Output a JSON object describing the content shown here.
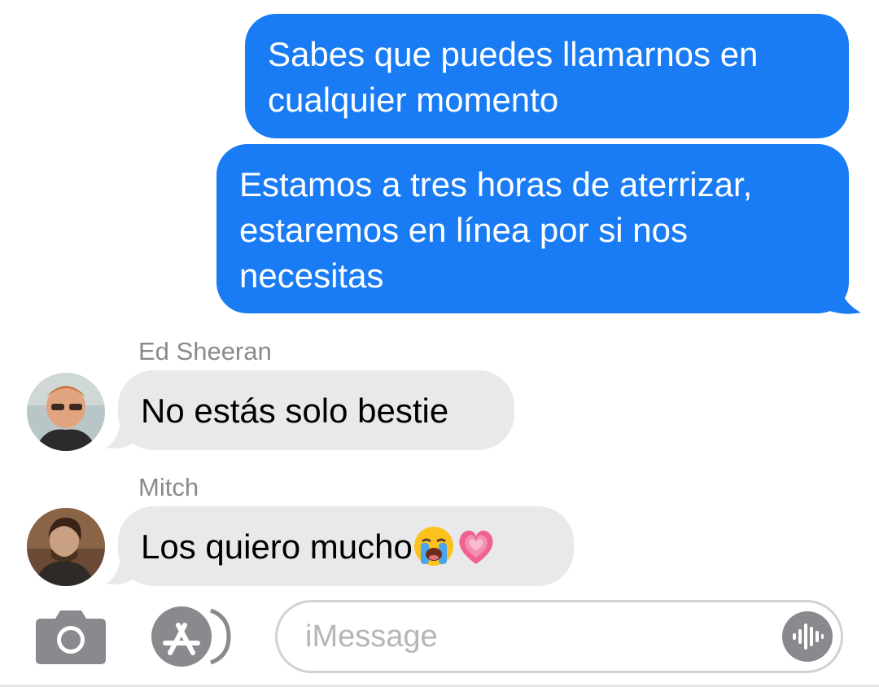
{
  "conversation": {
    "outgoing": [
      {
        "lines": [
          "Sabes que puedes llamarnos en",
          "cualquier momento"
        ]
      },
      {
        "lines": [
          "Estamos a tres horas de aterrizar,",
          "estaremos en línea por si nos",
          "necesitas"
        ]
      }
    ],
    "incoming": [
      {
        "sender": "Ed Sheeran",
        "text": "No estás solo bestie",
        "emoji": []
      },
      {
        "sender": "Mitch",
        "text": "Los quiero mucho",
        "emoji": [
          "loudly-crying-face",
          "growing-heart"
        ]
      }
    ]
  },
  "input_bar": {
    "placeholder": "iMessage",
    "icons": [
      "camera-icon",
      "app-store-icon",
      "audio-waveform-icon"
    ]
  },
  "colors": {
    "outgoing_bubble": "#1a7cf5",
    "incoming_bubble": "#e9e9eb",
    "sender_name": "#8a8a8e",
    "placeholder": "#b5b5ba",
    "icon_gray": "#8a8a8e"
  }
}
